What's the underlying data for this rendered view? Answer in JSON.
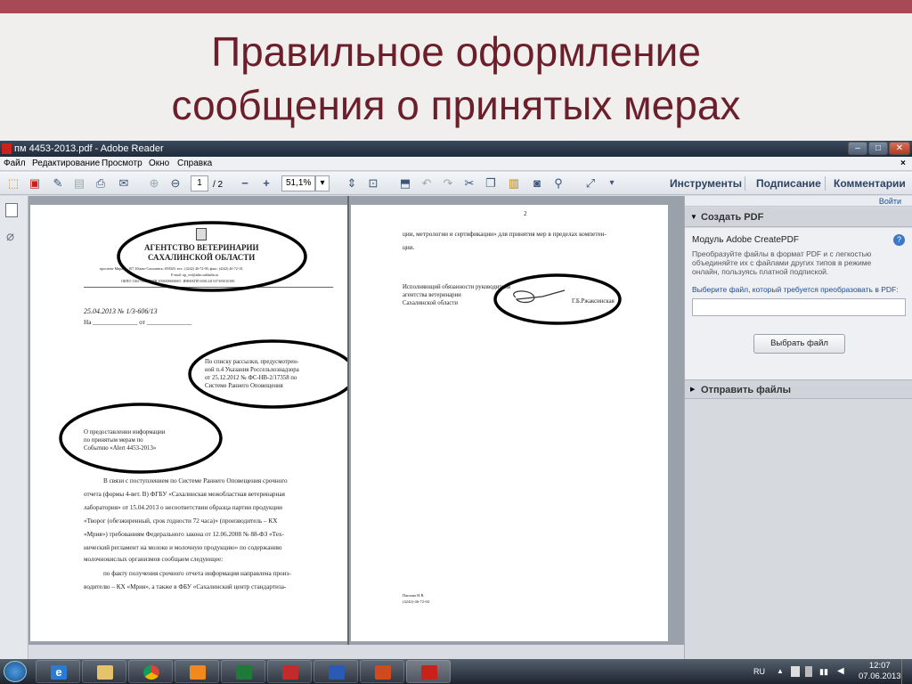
{
  "slide": {
    "title_line1": "Правильное оформление",
    "title_line2": "сообщения о принятых мерах"
  },
  "window": {
    "title": "пм 4453-2013.pdf - Adobe Reader",
    "menu": [
      "Файл",
      "Редактирование",
      "Просмотр",
      "Окно",
      "Справка"
    ],
    "close_x": "×",
    "controls": {
      "minimize": "–",
      "maximize": "□",
      "close": "✕"
    }
  },
  "toolbar": {
    "page_current": "1",
    "page_total": "/ 2",
    "zoom": "51,1%",
    "zoom_arrow": "▾",
    "links": [
      "Инструменты",
      "Подписание",
      "Комментарии"
    ]
  },
  "pdf": {
    "p1": {
      "org_line1": "АГЕНТСТВО ВЕТЕРИНАРИИ",
      "org_line2": "САХАЛИНСКОЙ ОБЛАСТИ",
      "address": "проспект Мира, д. 107, Южно-Сахалинск, 693020, тел.: (4242) 46-72-00, факс: (4242) 46-72-10,",
      "email": "E-mail: up_vet@adm.sakhalin.ru",
      "codes": "ОКПО 11657906, ОГРН 1056500606667, ИНН/КПП 6501241537/650101001",
      "reg_number": "25.04.2013 № 1/3-606/13",
      "na_line": "На ______________ от ______________",
      "addressee": [
        "По списку рассылки, предусмотрен-",
        "ной п.4 Указания Россельхознадзора",
        "от 25.12.2012 № ФС-НВ-2/17358 по",
        "Системе Раннего Оповещения"
      ],
      "subject": [
        "О предоставлении информации",
        "по принятым мерам по",
        "Событию «Alert 4453-2013»"
      ],
      "body": [
        "В связи с поступлением по Системе Раннего Оповещения срочного",
        "отчета (формы 4-вет. В) ФГБУ «Сахалинская межобластная ветеринарная",
        "лаборатория» от 15.04.2013 о несоответствии образца партии продукции",
        "«Творог (обезжиренный, срок годности 72 часа)» (производитель – КХ",
        "«Мрия») требованиям Федерального закона от 12.06.2008 № 88-ФЗ «Тех-",
        "нический регламент на молоко и молочную продукцию» по содержанию",
        "молочнокислых организмов сообщаем следующее:",
        "по факту получения срочного отчета информация направлена произ-",
        "водителю – КХ «Мрия», а также в ФБУ «Сахалинский центр стандартиза-"
      ]
    },
    "p2": {
      "page_num": "2",
      "cont_line1": "ции, метрологии и сертификации» для принятия мер в пределах компетен-",
      "cont_line2": "ции.",
      "sign_lines": [
        "Исполняющий обязанности руководителя",
        "агентства ветеринарии",
        "Сахалинской области"
      ],
      "signer": "Г.Б.Ржаксинская",
      "executor": "Пашова Н.В.",
      "executor_phone": "(4242)-46-72-04"
    }
  },
  "right_panel": {
    "login": "Войти",
    "create_pdf": "Создать PDF",
    "module_title": "Модуль Adobe CreatePDF",
    "module_desc": [
      "Преобразуйте файлы в формат PDF и с легкостью",
      "объединяйте их с файлами других типов в режиме",
      "онлайн, пользуясь платной подпиской."
    ],
    "select_prompt": "Выберите файл, который требуется преобразовать в PDF:",
    "choose_button": "Выбрать файл",
    "send_files": "Отправить файлы",
    "expanded_arrow": "▼",
    "collapsed_arrow": "▶",
    "help": "?"
  },
  "taskbar": {
    "lang": "RU",
    "time": "12:07",
    "date": "07.06.2013"
  },
  "colors": {
    "slide_title": "#6b1f2a",
    "accent_bar": "#a64a55",
    "panel_link": "#1a4d99",
    "pdf_red": "#c8221a"
  }
}
